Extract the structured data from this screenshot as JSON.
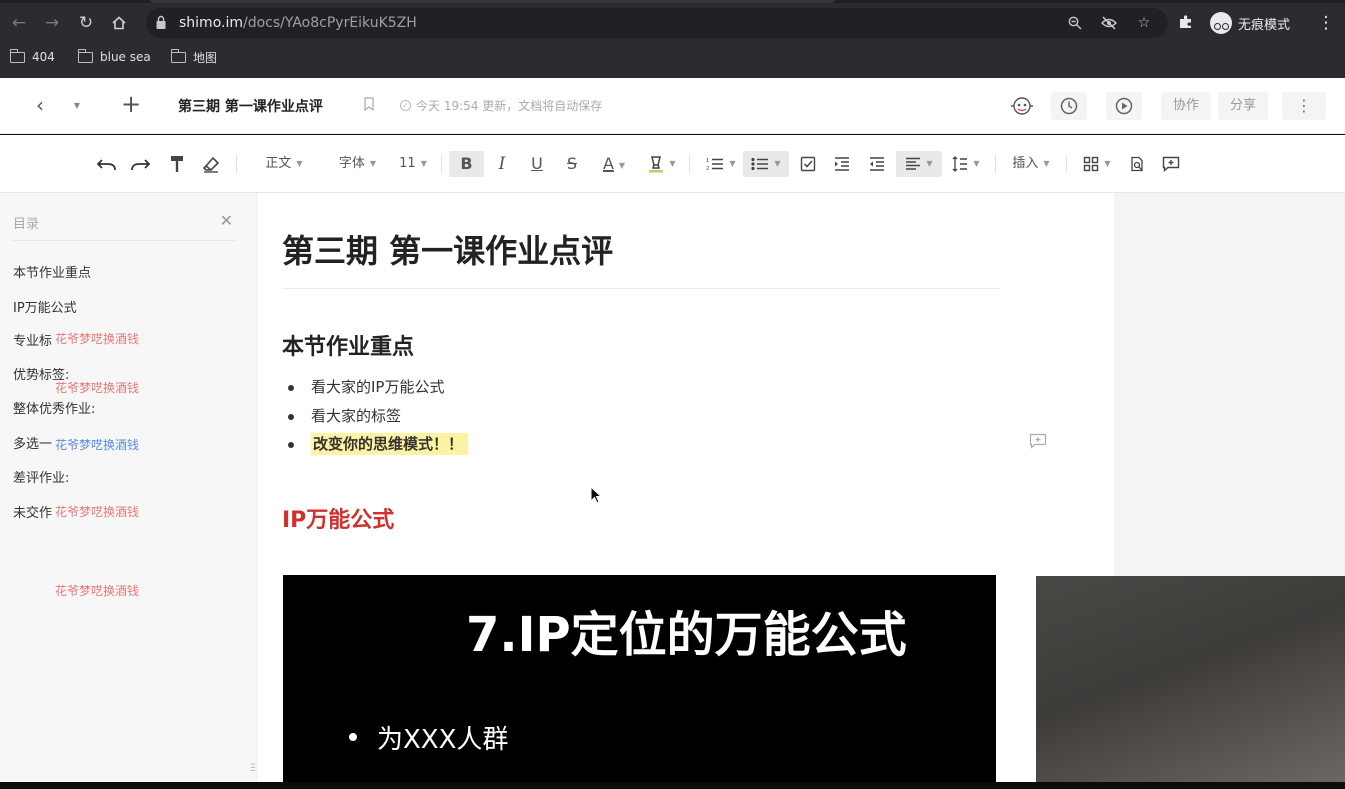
{
  "browser": {
    "url_host": "shimo.im",
    "url_path": "/docs/YAo8cPyrEikuK5ZH",
    "incognito_label": "无痕模式",
    "bookmarks": [
      "404",
      "blue sea",
      "地图"
    ]
  },
  "header": {
    "doc_title": "第三期 第一课作业点评",
    "save_status": "今天 19:54 更新，文档将自动保存",
    "collaborate_label": "协作",
    "share_label": "分享"
  },
  "toolbar": {
    "style_label": "正文",
    "font_label": "字体",
    "size_label": "11",
    "bold": "B",
    "italic": "I",
    "underline": "U",
    "strike": "S",
    "font_color": "A",
    "insert_label": "插入"
  },
  "outline": {
    "title": "目录",
    "items": [
      "本节作业重点",
      "IP万能公式",
      "专业标",
      "优势标签:",
      "整体优秀作业:",
      "多选一",
      "差评作业:",
      "未交作"
    ],
    "watermark": "花爷梦呓换酒钱"
  },
  "document": {
    "title": "第三期 第一课作业点评",
    "section1_heading": "本节作业重点",
    "section1_items": [
      "看大家的IP万能公式",
      "看大家的标签",
      "改变你的思维模式！！"
    ],
    "section2_heading": "IP万能公式",
    "slide_title": "7.IP定位的万能公式",
    "slide_bullet": "为XXX人群"
  },
  "colors": {
    "chrome_bg": "#2b2c2f",
    "accent_red": "#d0312d",
    "highlight": "#fdf3a3",
    "watermark_red": "#e67a78",
    "watermark_blue": "#5b8bd9"
  }
}
